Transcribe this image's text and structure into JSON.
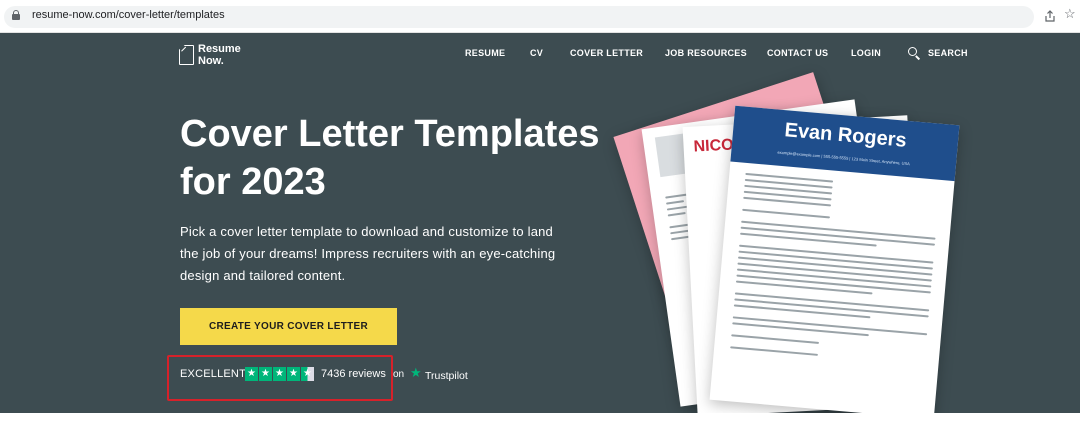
{
  "browser": {
    "url": "resume-now.com/cover-letter/templates",
    "share_icon": "share-icon",
    "bookmark_icon": "star-outline-icon"
  },
  "header": {
    "logo_line1": "Resume",
    "logo_line2": "Now.",
    "nav": [
      "RESUME",
      "CV",
      "COVER LETTER",
      "JOB RESOURCES",
      "CONTACT US",
      "LOGIN"
    ],
    "search_label": "SEARCH"
  },
  "hero": {
    "title": "Cover Letter Templates for 2023",
    "subtitle": "Pick a cover letter template to download and customize to land the job of your dreams! Impress recruiters with an eye-catching design and tailored content.",
    "cta_label": "CREATE YOUR COVER LETTER"
  },
  "trustpilot": {
    "rating_label": "EXCELLENT",
    "rating_stars": 4.5,
    "max_stars": 5,
    "reviews": "7436 reviews",
    "on_label": "on",
    "brand": "Trustpilot"
  },
  "preview": {
    "front_name": "Evan Rogers",
    "front_contact": "example@example.com | 555-555-5555 | 123 Main Street, Anywhere, USA",
    "back_name": "NICO"
  },
  "colors": {
    "hero_bg": "#3d4c51",
    "cta_bg": "#f5d94a",
    "trustpilot_green": "#00b67a",
    "highlight": "#d6212a",
    "template_band": "#1f4e8c"
  }
}
